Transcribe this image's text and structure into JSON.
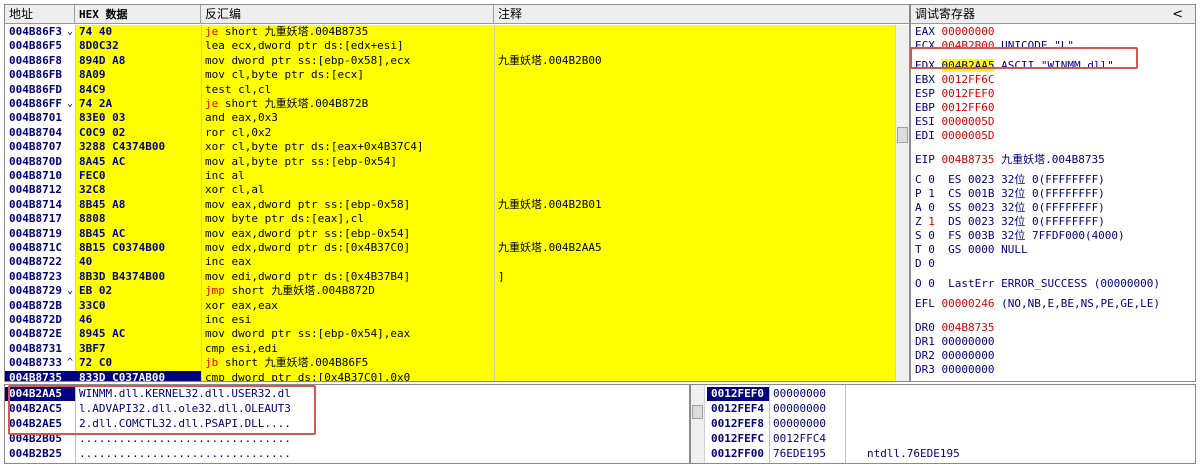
{
  "disasm": {
    "headers": {
      "addr": "地址",
      "hex": "HEX 数据",
      "asm": "反汇编",
      "comment": "注释"
    },
    "rows": [
      {
        "addr": "004B86F3",
        "mark": "⌄",
        "hex": "74 40",
        "kw": "je",
        "asm": " short 九重妖塔.004B8735",
        "comment": ""
      },
      {
        "addr": "004B86F5",
        "mark": "",
        "hex": "8D0C32",
        "kw": "",
        "asm": "lea ecx,dword ptr ds:[edx+esi]",
        "comment": ""
      },
      {
        "addr": "004B86F8",
        "mark": "",
        "hex": "894D A8",
        "kw": "",
        "asm": "mov dword ptr ss:[ebp-0x58],ecx",
        "comment": "九重妖塔.004B2B00"
      },
      {
        "addr": "004B86FB",
        "mark": "",
        "hex": "8A09",
        "kw": "",
        "asm": "mov cl,byte ptr ds:[ecx]",
        "comment": ""
      },
      {
        "addr": "004B86FD",
        "mark": "",
        "hex": "84C9",
        "kw": "",
        "asm": "test cl,cl",
        "comment": ""
      },
      {
        "addr": "004B86FF",
        "mark": "⌄",
        "hex": "74 2A",
        "kw": "je",
        "asm": " short 九重妖塔.004B872B",
        "comment": ""
      },
      {
        "addr": "004B8701",
        "mark": "",
        "hex": "83E0 03",
        "kw": "",
        "asm": "and eax,0x3",
        "comment": ""
      },
      {
        "addr": "004B8704",
        "mark": "",
        "hex": "C0C9 02",
        "kw": "",
        "asm": "ror cl,0x2",
        "comment": ""
      },
      {
        "addr": "004B8707",
        "mark": "",
        "hex": "3288 C4374B00",
        "kw": "",
        "asm": "xor cl,byte ptr ds:[eax+0x4B37C4]",
        "comment": ""
      },
      {
        "addr": "004B870D",
        "mark": "",
        "hex": "8A45 AC",
        "kw": "",
        "asm": "mov al,byte ptr ss:[ebp-0x54]",
        "comment": ""
      },
      {
        "addr": "004B8710",
        "mark": "",
        "hex": "FEC0",
        "kw": "",
        "asm": "inc al",
        "comment": ""
      },
      {
        "addr": "004B8712",
        "mark": "",
        "hex": "32C8",
        "kw": "",
        "asm": "xor cl,al",
        "comment": ""
      },
      {
        "addr": "004B8714",
        "mark": "",
        "hex": "8B45 A8",
        "kw": "",
        "asm": "mov eax,dword ptr ss:[ebp-0x58]",
        "comment": "九重妖塔.004B2B01"
      },
      {
        "addr": "004B8717",
        "mark": "",
        "hex": "8808",
        "kw": "",
        "asm": "mov byte ptr ds:[eax],cl",
        "comment": ""
      },
      {
        "addr": "004B8719",
        "mark": "",
        "hex": "8B45 AC",
        "kw": "",
        "asm": "mov eax,dword ptr ss:[ebp-0x54]",
        "comment": ""
      },
      {
        "addr": "004B871C",
        "mark": "",
        "hex": "8B15 C0374B00",
        "kw": "",
        "asm": "mov edx,dword ptr ds:[0x4B37C0]",
        "comment": "九重妖塔.004B2AA5"
      },
      {
        "addr": "004B8722",
        "mark": "",
        "hex": "40",
        "kw": "",
        "asm": "inc eax",
        "comment": ""
      },
      {
        "addr": "004B8723",
        "mark": "",
        "hex": "8B3D B4374B00",
        "kw": "",
        "asm": "mov edi,dword ptr ds:[0x4B37B4]",
        "comment": "]"
      },
      {
        "addr": "004B8729",
        "mark": "⌄",
        "hex": "EB 02",
        "kw": "jmp",
        "asm": " short 九重妖塔.004B872D",
        "comment": ""
      },
      {
        "addr": "004B872B",
        "mark": "",
        "hex": "33C0",
        "kw": "",
        "asm": "xor eax,eax",
        "comment": ""
      },
      {
        "addr": "004B872D",
        "mark": "",
        "hex": "46",
        "kw": "",
        "asm": "inc esi",
        "comment": ""
      },
      {
        "addr": "004B872E",
        "mark": "",
        "hex": "8945 AC",
        "kw": "",
        "asm": "mov dword ptr ss:[ebp-0x54],eax",
        "comment": ""
      },
      {
        "addr": "004B8731",
        "mark": "",
        "hex": "3BF7",
        "kw": "",
        "asm": "cmp esi,edi",
        "comment": ""
      },
      {
        "addr": "004B8733",
        "mark": "^",
        "hex": "72 C0",
        "kw": "jb",
        "asm": " short 九重妖塔.004B86F5",
        "comment": ""
      },
      {
        "addr": "004B8735",
        "mark": "",
        "hex": "833D C037AB00",
        "kw": "",
        "asm": "cmp dword ptr ds:[0x4B37C0],0x0",
        "comment": ""
      }
    ]
  },
  "registers": {
    "title": "调试寄存器",
    "collapse": "<",
    "lines": [
      {
        "pre": "EAX ",
        "val": "00000000",
        "post": ""
      },
      {
        "pre": "ECX ",
        "val": "004B2B00",
        "post": " UNICODE \"L\""
      },
      {
        "pre": "EDX ",
        "val": "004B2AA5",
        "post": " ASCII \"WINMM.dll\""
      },
      {
        "pre": "EBX ",
        "val": "0012FF6C",
        "post": ""
      },
      {
        "pre": "ESP ",
        "val": "0012FEF0",
        "post": ""
      },
      {
        "pre": "EBP ",
        "val": "0012FF60",
        "post": ""
      },
      {
        "pre": "ESI ",
        "val": "0000005D",
        "post": ""
      },
      {
        "pre": "EDI ",
        "val": "0000005D",
        "post": ""
      },
      {
        "pre": "EIP ",
        "val": "004B8735",
        "post": " 九重妖塔.004B8735"
      },
      {
        "pre": "C 0  ES 0023 32位 0(FFFFFFFF)",
        "val": "",
        "post": ""
      },
      {
        "pre": "P 1  CS 001B 32位 0(FFFFFFFF)",
        "val": "",
        "post": ""
      },
      {
        "pre": "A 0  SS 0023 32位 0(FFFFFFFF)",
        "val": "",
        "post": ""
      },
      {
        "pre": "Z ",
        "val": "1",
        "post": "  DS 0023 32位 0(FFFFFFFF)"
      },
      {
        "pre": "S 0  FS 003B 32位 7FFDF000(4000)",
        "val": "",
        "post": ""
      },
      {
        "pre": "T 0  GS 0000 NULL",
        "val": "",
        "post": ""
      },
      {
        "pre": "D 0",
        "val": "",
        "post": ""
      },
      {
        "pre": "O 0  LastErr ERROR_SUCCESS (00000000)",
        "val": "",
        "post": ""
      },
      {
        "pre": "EFL ",
        "val": "00000246",
        "post": " (NO,NB,E,BE,NS,PE,GE,LE)"
      },
      {
        "pre": "DR0 ",
        "val": "004B8735",
        "post": ""
      },
      {
        "pre": "DR1 00000000",
        "val": "",
        "post": ""
      },
      {
        "pre": "DR2 00000000",
        "val": "",
        "post": ""
      },
      {
        "pre": "DR3 00000000",
        "val": "",
        "post": ""
      }
    ]
  },
  "dump": {
    "rows": [
      {
        "addr": "004B2AA5",
        "text": "WINMM.dll.KERNEL32.dll.USER32.dl"
      },
      {
        "addr": "004B2AC5",
        "text": "l.ADVAPI32.dll.ole32.dll.OLEAUT3"
      },
      {
        "addr": "004B2AE5",
        "text": "2.dll.COMCTL32.dll.PSAPI.DLL...."
      },
      {
        "addr": "004B2B05",
        "text": "................................"
      },
      {
        "addr": "004B2B25",
        "text": "................................"
      }
    ]
  },
  "stack": {
    "rows": [
      {
        "addr": "0012FEF0",
        "val": "00000000",
        "comment": ""
      },
      {
        "addr": "0012FEF4",
        "val": "00000000",
        "comment": ""
      },
      {
        "addr": "0012FEF8",
        "val": "00000000",
        "comment": ""
      },
      {
        "addr": "0012FEFC",
        "val": "0012FFC4",
        "comment": ""
      },
      {
        "addr": "0012FF00",
        "val": "76EDE195",
        "comment": "ntdll.76EDE195"
      }
    ]
  },
  "colors": {
    "highlight": "#ffff00",
    "address": "#000080",
    "keyword": "#e00000",
    "annotation": "#d9534f"
  }
}
